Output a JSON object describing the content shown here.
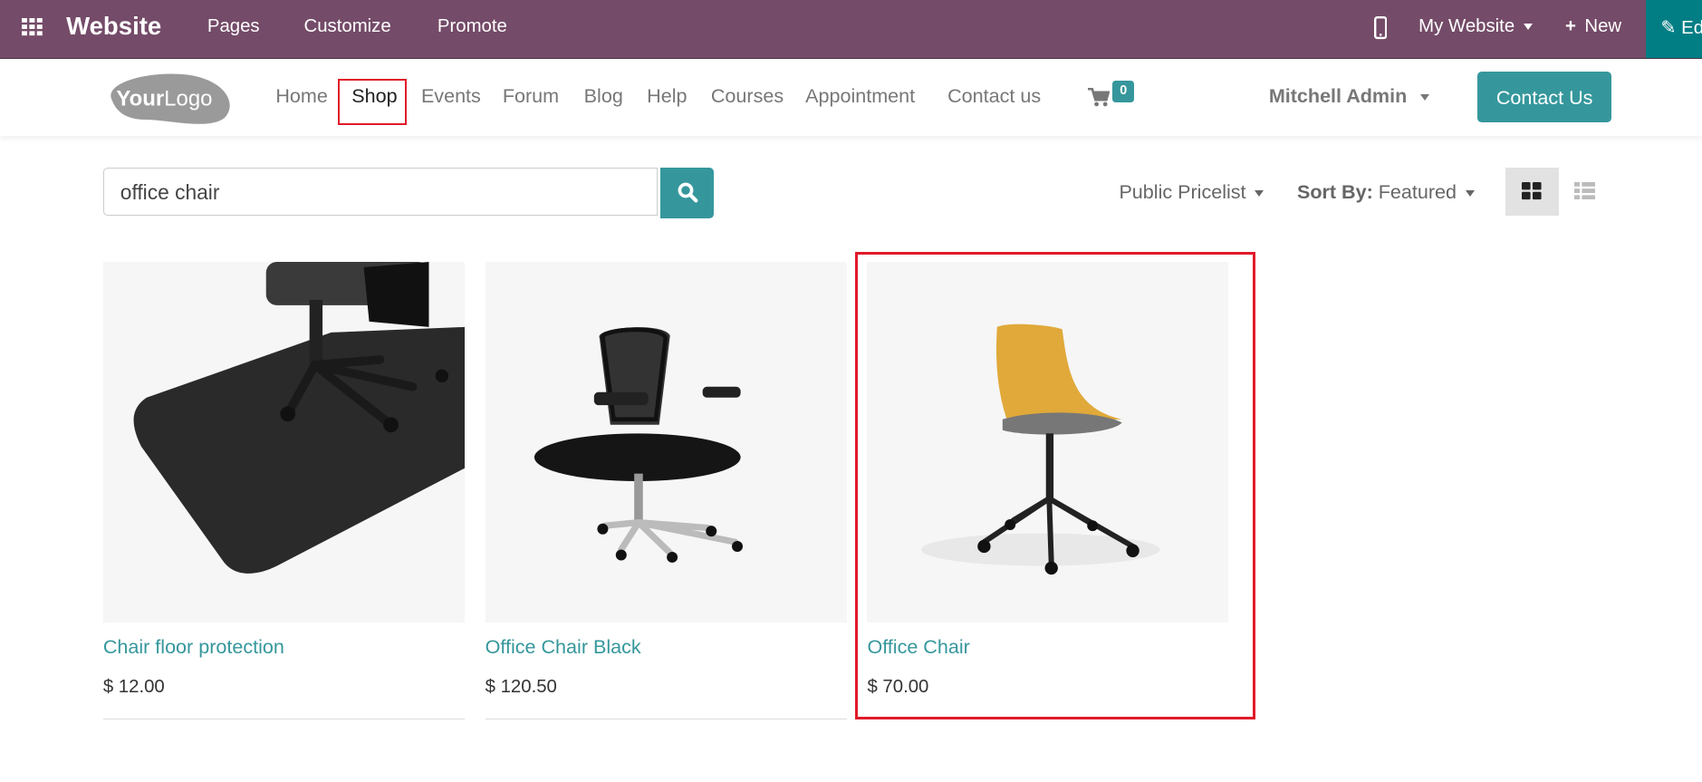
{
  "topbar": {
    "app_title": "Website",
    "menu": [
      "Pages",
      "Customize",
      "Promote"
    ],
    "site_selector": "My Website",
    "new_label": "New",
    "edit_label": "Edit",
    "bg_color": "#744b68",
    "edit_color": "#017e84"
  },
  "nav": {
    "logo_text": "YourLogo",
    "items": [
      "Home",
      "Shop",
      "Events",
      "Forum",
      "Blog",
      "Help",
      "Courses",
      "Appointment",
      "Contact us"
    ],
    "active": "Shop",
    "cart_count": "0",
    "user": "Mitchell Admin",
    "contact_button": "Contact Us",
    "accent": "#35979c"
  },
  "toolbar": {
    "search_value": "office chair",
    "pricelist": "Public Pricelist",
    "sort_label": "Sort By:",
    "sort_value": "Featured",
    "view_mode": "grid"
  },
  "products": [
    {
      "name": "Chair floor protection",
      "price": "$ 12.00"
    },
    {
      "name": "Office Chair Black",
      "price": "$ 120.50"
    },
    {
      "name": "Office Chair",
      "price": "$ 70.00",
      "highlighted": true
    }
  ]
}
